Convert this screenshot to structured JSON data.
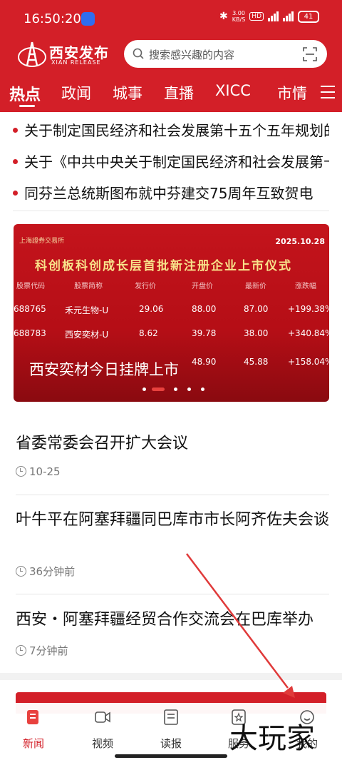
{
  "status": {
    "time": "16:50:20",
    "speed_top": "3.00",
    "speed_bottom": "KB/S",
    "hd": "HD",
    "battery": "41"
  },
  "brand": {
    "name_cn": "西安发布",
    "name_en": "XIAN RELEASE"
  },
  "search": {
    "placeholder": "搜索感兴趣的内容"
  },
  "tabs": [
    {
      "label": "热点"
    },
    {
      "label": "政闻"
    },
    {
      "label": "城事"
    },
    {
      "label": "直播"
    },
    {
      "label": "XICC"
    },
    {
      "label": "市情"
    }
  ],
  "ticker": [
    {
      "text": "关于制定国民经济和社会发展第十五个五年规划的建议"
    },
    {
      "text": "关于《中共中央关于制定国民经济和社会发展第十五个五年规划的建议》"
    },
    {
      "text": "同芬兰总统斯图布就中芬建交75周年互致贺电"
    }
  ],
  "banner": {
    "exchange": "上海證券交易所",
    "date": "2025.10.28",
    "headline": "科创板科创成长层首批新注册企业上市仪式",
    "columns": [
      "股票代码",
      "股票简称",
      "发行价",
      "开盘价",
      "最新价",
      "涨跌幅"
    ],
    "rows": [
      [
        "688765",
        "禾元生物-U",
        "29.06",
        "88.00",
        "87.00",
        "+199.38%"
      ],
      [
        "688783",
        "西安奕材-U",
        "8.62",
        "39.78",
        "38.00",
        "+340.84%"
      ],
      [
        "",
        "",
        "48.90",
        "",
        "45.88",
        "+158.04%"
      ]
    ],
    "caption": "西安奕材今日挂牌上市",
    "slides": 5,
    "active_slide": 1
  },
  "news": [
    {
      "title": "省委常委会召开扩大会议",
      "time": "10-25"
    },
    {
      "title": "叶牛平在阿塞拜疆同巴库市市长阿齐佐夫会谈",
      "time": "36分钟前"
    },
    {
      "title": "西安・阿塞拜疆经贸合作交流会在巴库举办",
      "time": "7分钟前"
    }
  ],
  "bottom_nav": [
    {
      "label": "新闻",
      "icon": "news-icon",
      "active": true
    },
    {
      "label": "视频",
      "icon": "video-icon",
      "active": false
    },
    {
      "label": "读报",
      "icon": "newspaper-icon",
      "active": false
    },
    {
      "label": "服务",
      "icon": "service-icon",
      "active": false
    },
    {
      "label": "我的",
      "icon": "profile-icon",
      "active": false
    }
  ],
  "watermark": "大玩家",
  "colors": {
    "brand_red": "#d31f28",
    "annotation_red": "#e03a3a"
  }
}
